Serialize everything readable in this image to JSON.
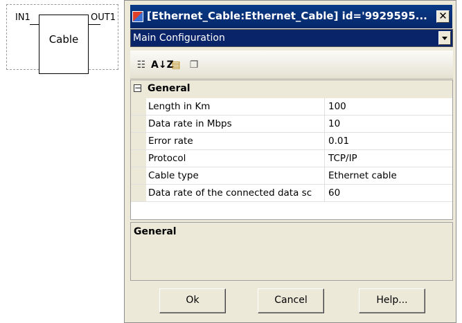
{
  "diagram": {
    "block_label": "Cable",
    "port_in": "IN1",
    "port_out": "OUT1"
  },
  "dialog": {
    "title": "[Ethernet_Cable:Ethernet_Cable] id='9929595...",
    "close_symbol": "✕",
    "dropdown_value": "Main Configuration",
    "toolbar": {
      "icons": [
        "categorized-icon",
        "alphabetical-sort-icon",
        "property-pages-icon",
        "pages-icon"
      ],
      "az_glyph": "A↓Z"
    },
    "grid": {
      "category_toggle": "−",
      "category": "General",
      "rows": [
        {
          "name": "Length in Km",
          "value": "100"
        },
        {
          "name": "Data rate in Mbps",
          "value": "10"
        },
        {
          "name": "Error rate",
          "value": "0.01"
        },
        {
          "name": "Protocol",
          "value": "TCP/IP"
        },
        {
          "name": "Cable type",
          "value": "Ethernet cable"
        },
        {
          "name": "Data rate of the connected data sc",
          "value": "60"
        }
      ]
    },
    "description": {
      "title": "General"
    },
    "buttons": {
      "ok": "Ok",
      "cancel": "Cancel",
      "help": "Help..."
    }
  }
}
